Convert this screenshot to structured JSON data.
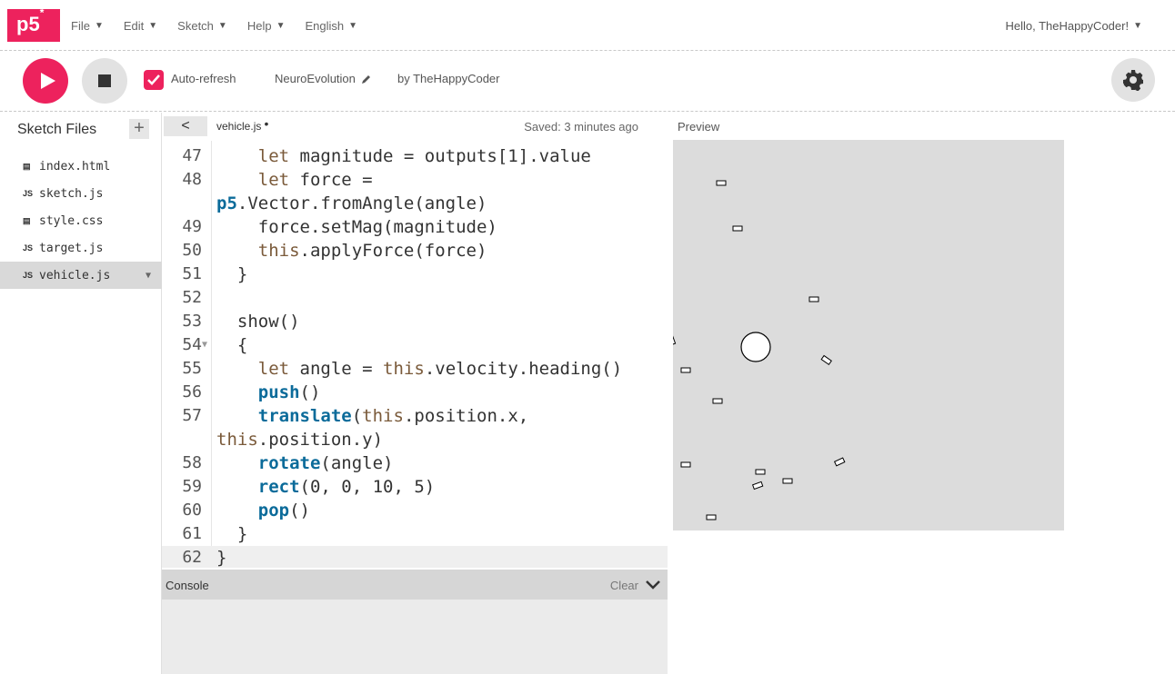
{
  "app": {
    "logo": "p5",
    "logo_sup": "*"
  },
  "nav": {
    "menus": [
      {
        "label": "File"
      },
      {
        "label": "Edit"
      },
      {
        "label": "Sketch"
      },
      {
        "label": "Help"
      },
      {
        "label": "English"
      }
    ],
    "user_greeting": "Hello, TheHappyCoder!"
  },
  "toolbar": {
    "play_icon": "play-icon",
    "stop_icon": "stop-icon",
    "auto_refresh_label": "Auto-refresh",
    "auto_refresh_checked": true,
    "sketch_name": "NeuroEvolution",
    "by_label": "by TheHappyCoder",
    "settings_icon": "gear-icon"
  },
  "sidebar": {
    "title": "Sketch Files",
    "add_label": "+",
    "files": [
      {
        "icon": "html-file-icon",
        "badge": "▤",
        "name": "index.html"
      },
      {
        "icon": "js-file-icon",
        "badge": "JS",
        "name": "sketch.js"
      },
      {
        "icon": "css-file-icon",
        "badge": "▤",
        "name": "style.css"
      },
      {
        "icon": "js-file-icon",
        "badge": "JS",
        "name": "target.js"
      },
      {
        "icon": "js-file-icon",
        "badge": "JS",
        "name": "vehicle.js",
        "active": true
      }
    ]
  },
  "editor": {
    "collapse_label": "<",
    "tab_name": "vehicle.js",
    "unsaved_dot": "•",
    "saved_status": "Saved: 3 minutes ago",
    "lines": [
      {
        "n": "47",
        "t": "    let magnitude = outputs[1].value"
      },
      {
        "n": "48",
        "t": "    let force ="
      },
      {
        "n": "",
        "t": "p5.Vector.fromAngle(angle)"
      },
      {
        "n": "49",
        "t": "    force.setMag(magnitude)"
      },
      {
        "n": "50",
        "t": "    this.applyForce(force)"
      },
      {
        "n": "51",
        "t": "  }"
      },
      {
        "n": "52",
        "t": ""
      },
      {
        "n": "53",
        "t": "  show()"
      },
      {
        "n": "54",
        "t": "  {"
      },
      {
        "n": "55",
        "t": "    let angle = this.velocity.heading()"
      },
      {
        "n": "56",
        "t": "    push()"
      },
      {
        "n": "57",
        "t": "    translate(this.position.x,"
      },
      {
        "n": "",
        "t": "this.position.y)"
      },
      {
        "n": "58",
        "t": "    rotate(angle)"
      },
      {
        "n": "59",
        "t": "    rect(0, 0, 10, 5)"
      },
      {
        "n": "60",
        "t": "    pop()"
      },
      {
        "n": "61",
        "t": "  }"
      },
      {
        "n": "62",
        "t": "}"
      }
    ]
  },
  "console": {
    "title": "Console",
    "clear_label": "Clear"
  },
  "preview": {
    "label": "Preview"
  }
}
